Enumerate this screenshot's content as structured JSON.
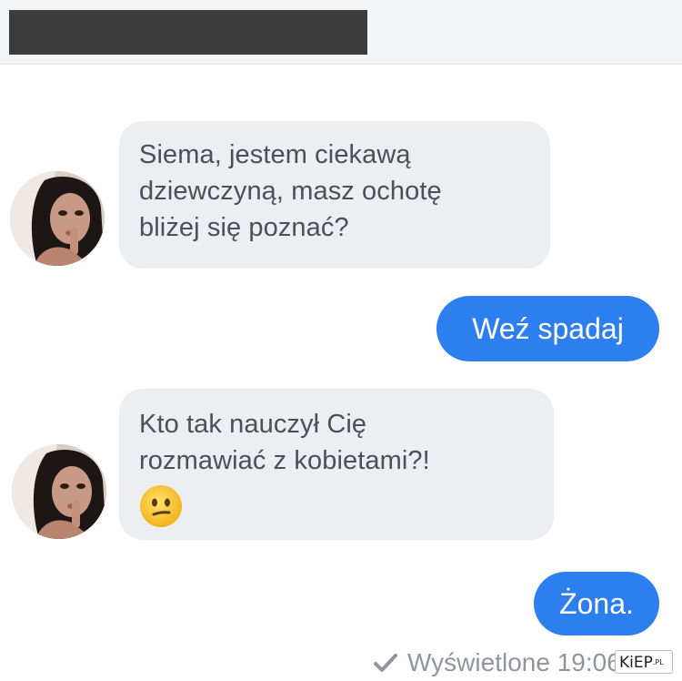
{
  "header": {
    "contact_name_redacted": true
  },
  "messages": [
    {
      "direction": "incoming",
      "lines": [
        "Siema, jestem ciekawą",
        "dziewczyną, masz ochotę",
        "bliżej się poznać?"
      ]
    },
    {
      "direction": "outgoing",
      "text": "Weź spadaj"
    },
    {
      "direction": "incoming",
      "lines": [
        "Kto tak nauczył Cię",
        "rozmawiać z kobietami?!"
      ],
      "emoji": "confused-face-emoji"
    },
    {
      "direction": "outgoing",
      "text": "Żona."
    }
  ],
  "status": {
    "seen_label": "Wyświetlone 19:06",
    "icon": "check-icon"
  },
  "watermark": {
    "brand": "KiEP",
    "tld": ".PL"
  },
  "colors": {
    "outgoing_bubble": "#2d7ff0",
    "incoming_bubble": "#eceef1",
    "incoming_text": "#4b4f56",
    "status_text": "#90949c"
  }
}
